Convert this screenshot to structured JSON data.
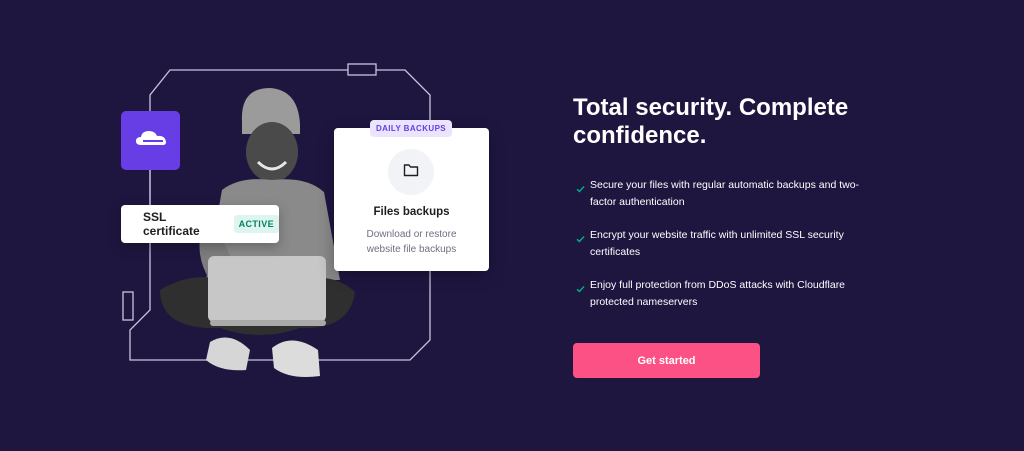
{
  "illustration": {
    "ssl": {
      "label": "SSL certificate",
      "status": "ACTIVE"
    },
    "backups": {
      "badge": "DAILY BACKUPS",
      "title": "Files backups",
      "description": "Download or restore website file backups"
    },
    "icons": {
      "cloud": "cloudflare-cloud-icon",
      "folder": "folder-icon"
    }
  },
  "content": {
    "headline": "Total security. Complete confidence.",
    "features": [
      "Secure your files with regular automatic backups and two-factor authentication",
      "Encrypt your website traffic with unlimited SSL security certificates",
      "Enjoy full protection from DDoS attacks with Cloudflare protected nameservers"
    ],
    "cta_label": "Get started"
  },
  "colors": {
    "background": "#1f1640",
    "accent_purple": "#673de6",
    "cta_pink": "#fc5185",
    "check_teal": "#00b090",
    "active_green": "#008361"
  }
}
